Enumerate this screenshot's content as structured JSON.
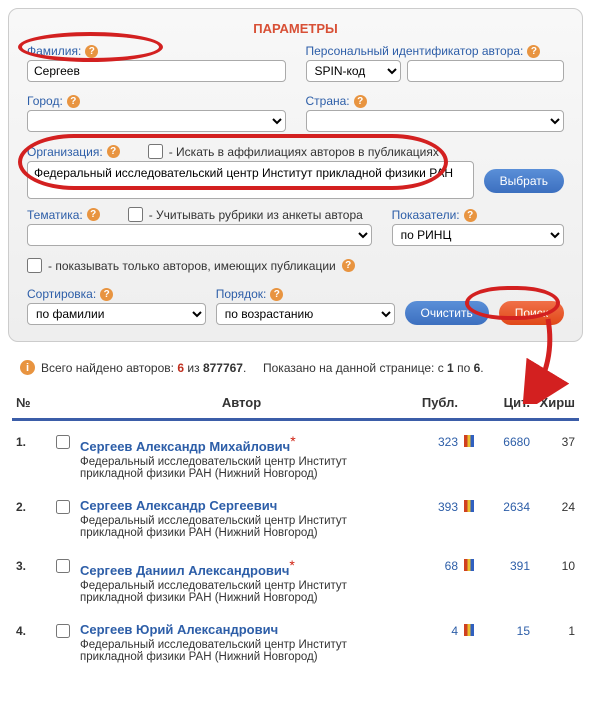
{
  "panel": {
    "title": "ПАРАМЕТРЫ",
    "famLabel": "Фамилия:",
    "famValue": "Сергеев",
    "pidLabel": "Персональный идентификатор автора:",
    "pidType": "SPIN-код",
    "pidValue": "",
    "cityLabel": "Город:",
    "cityValue": "",
    "countryLabel": "Страна:",
    "countryValue": "",
    "orgLabel": "Организация:",
    "orgAffilCheck": "- Искать в аффилиациях авторов в публикациях",
    "orgValue": "Федеральный исследовательский центр Институт прикладной физики РАН",
    "selectBtn": "Выбрать",
    "themeLabel": "Тематика:",
    "themeCheck": "- Учитывать рубрики из анкеты автора",
    "themeValue": "",
    "indexLabel": "Показатели:",
    "indexValue": "по РИНЦ",
    "onlyPubCheck": "- показывать только авторов, имеющих публикации",
    "sortLabel": "Сортировка:",
    "sortValue": "по фамилии",
    "orderLabel": "Порядок:",
    "orderValue": "по возрастанию",
    "clearBtn": "Очистить",
    "searchBtn": "Поиск"
  },
  "results": {
    "infoPre": "Всего найдено авторов:",
    "found": "6",
    "infoMid1": "из",
    "total": "877767",
    "infoMid2": ".",
    "shownPre": "Показано на данной странице: с",
    "from": "1",
    "shownMid": "по",
    "to": "6",
    "shownEnd": "."
  },
  "headers": {
    "num": "№",
    "author": "Автор",
    "publ": "Публ.",
    "cit": "Цит.",
    "hirsh": "Хирш"
  },
  "rows": [
    {
      "n": "1.",
      "name": "Сергеев  Александр  Михайлович",
      "star": true,
      "affil": "Федеральный исследовательский центр Институт прикладной физики РАН (Нижний Новгород)",
      "publ": "323",
      "cit": "6680",
      "hirsh": "37"
    },
    {
      "n": "2.",
      "name": "Сергеев  Александр  Сергеевич",
      "star": false,
      "affil": "Федеральный исследовательский центр Институт прикладной физики РАН (Нижний Новгород)",
      "publ": "393",
      "cit": "2634",
      "hirsh": "24"
    },
    {
      "n": "3.",
      "name": "Сергеев  Даниил  Александрович",
      "star": true,
      "affil": "Федеральный исследовательский центр Институт прикладной физики РАН (Нижний Новгород)",
      "publ": "68",
      "cit": "391",
      "hirsh": "10"
    },
    {
      "n": "4.",
      "name": "Сергеев  Юрий  Александрович",
      "star": false,
      "affil": "Федеральный исследовательский центр Институт прикладной физики РАН (Нижний Новгород)",
      "publ": "4",
      "cit": "15",
      "hirsh": "1"
    }
  ]
}
